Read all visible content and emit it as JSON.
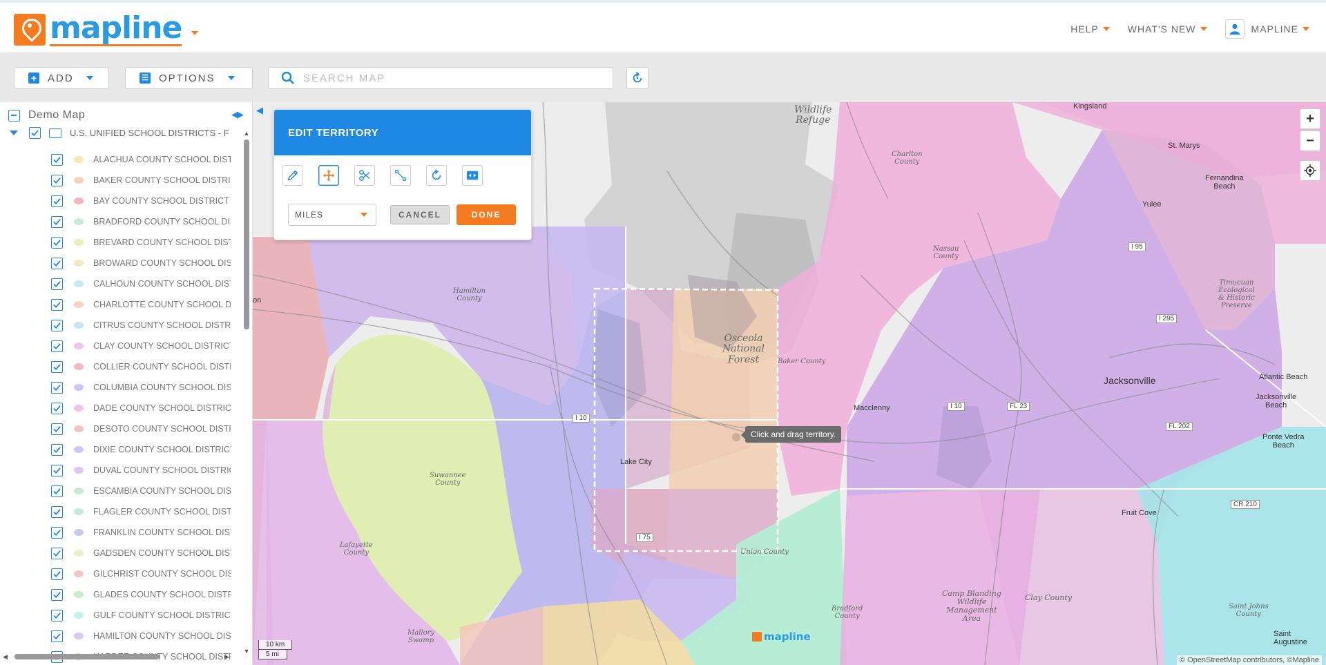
{
  "header": {
    "logo_text": "mapline",
    "nav": {
      "help": "HELP",
      "whats_new": "WHAT'S NEW",
      "account": "MAPLINE"
    }
  },
  "toolbar": {
    "add_label": "ADD",
    "options_label": "OPTIONS",
    "search_placeholder": "SEARCH MAP"
  },
  "sidebar": {
    "root_label": "Demo Map",
    "layer_label": "U.S. UNIFIED SCHOOL DISTRICTS - F",
    "items": [
      {
        "label": "ALACHUA COUNTY SCHOOL DISTRICT",
        "color": "#f6e7b8"
      },
      {
        "label": "BAKER COUNTY SCHOOL DISTRICT",
        "color": "#f6d2b8"
      },
      {
        "label": "BAY COUNTY SCHOOL DISTRICT",
        "color": "#f2b8b8"
      },
      {
        "label": "BRADFORD COUNTY SCHOOL DISTRICT",
        "color": "#c8ecd6"
      },
      {
        "label": "BREVARD COUNTY SCHOOL DISTRICT",
        "color": "#e3f2b8"
      },
      {
        "label": "BROWARD COUNTY SCHOOL DISTRICT",
        "color": "#f6e9b8"
      },
      {
        "label": "CALHOUN COUNTY SCHOOL DISTRICT",
        "color": "#c4e8f4"
      },
      {
        "label": "CHARLOTTE COUNTY SCHOOL DISTRICT",
        "color": "#f6d2c4"
      },
      {
        "label": "CITRUS COUNTY SCHOOL DISTRICT",
        "color": "#c4e6f6"
      },
      {
        "label": "CLAY COUNTY SCHOOL DISTRICT",
        "color": "#f0c4ec"
      },
      {
        "label": "COLLIER COUNTY SCHOOL DISTRICT",
        "color": "#f4bcbc"
      },
      {
        "label": "COLUMBIA COUNTY SCHOOL DISTRICT",
        "color": "#c8c8f4"
      },
      {
        "label": "DADE COUNTY SCHOOL DISTRICT",
        "color": "#f4c4e8"
      },
      {
        "label": "DESOTO COUNTY SCHOOL DISTRICT",
        "color": "#f4c4c4"
      },
      {
        "label": "DIXIE COUNTY SCHOOL DISTRICT",
        "color": "#cccaf4"
      },
      {
        "label": "DUVAL COUNTY SCHOOL DISTRICT",
        "color": "#dcc8f0"
      },
      {
        "label": "ESCAMBIA COUNTY SCHOOL DISTRICT",
        "color": "#c8ecd0"
      },
      {
        "label": "FLAGLER COUNTY SCHOOL DISTRICT",
        "color": "#c4ecdc"
      },
      {
        "label": "FRANKLIN COUNTY SCHOOL DISTRICT",
        "color": "#c8c8f4"
      },
      {
        "label": "GADSDEN COUNTY SCHOOL DISTRICT",
        "color": "#e6f2c4"
      },
      {
        "label": "GILCHRIST COUNTY SCHOOL DISTRICT",
        "color": "#f4c8c8"
      },
      {
        "label": "GLADES COUNTY SCHOOL DISTRICT",
        "color": "#c8ecc8"
      },
      {
        "label": "GULF COUNTY SCHOOL DISTRICT",
        "color": "#c4f0f4"
      },
      {
        "label": "HAMILTON COUNTY SCHOOL DISTRICT",
        "color": "#d8c8f4"
      },
      {
        "label": "HARDEE COUNTY SCHOOL DISTRICT",
        "color": "#f4c8c8"
      }
    ]
  },
  "panel": {
    "title": "EDIT TERRITORY",
    "units": "MILES",
    "cancel": "CANCEL",
    "done": "DONE"
  },
  "map": {
    "tooltip": "Click and drag territory.",
    "scale_km": "10 km",
    "scale_mi": "5 mi",
    "attribution": "© OpenStreetMap contributors, ©Mapline",
    "watermark": "mapline",
    "labels": {
      "wildlife_refuge": "Wildlife\nRefuge",
      "charlton": "Charlton\nCounty",
      "kingsland": "Kingsland",
      "st_marys": "St. Marys",
      "fernandina": "Fernandina\nBeach",
      "yulee": "Yulee",
      "nassau": "Nassau\nCounty",
      "hamilton": "Hamilton\nCounty",
      "osceola": "Osceola\nNational\nForest",
      "baker": "Baker County",
      "timucuan": "Timucuan\nEcological\n& Historic\nPreserve",
      "jacksonville": "Jacksonville",
      "atlantic_beach": "Atlantic Beach",
      "jax_beach": "Jacksonville\nBeach",
      "ponte_vedra": "Ponte Vedra\nBeach",
      "macclenny": "Macclenny",
      "lake_city": "Lake City",
      "suwannee": "Suwannee\nCounty",
      "lafayette": "Lafayette\nCounty",
      "union": "Union County",
      "bradford": "Bradford\nCounty",
      "camp_blanding": "Camp Blanding\nWildlife\nManagement\nArea",
      "clay": "Clay County",
      "fruit_cove": "Fruit Cove",
      "st_johns": "Saint Johns\nCounty",
      "st_augustine": "Saint Augustine",
      "mallory": "Mallory\nSwamp",
      "on": "on"
    },
    "roads": {
      "i95": "I 95",
      "i295": "I 295",
      "i10a": "I 10",
      "i10b": "I 10",
      "fl23": "FL 23",
      "fl202": "FL 202",
      "cr210": "CR 210",
      "i75": "I 75"
    }
  }
}
